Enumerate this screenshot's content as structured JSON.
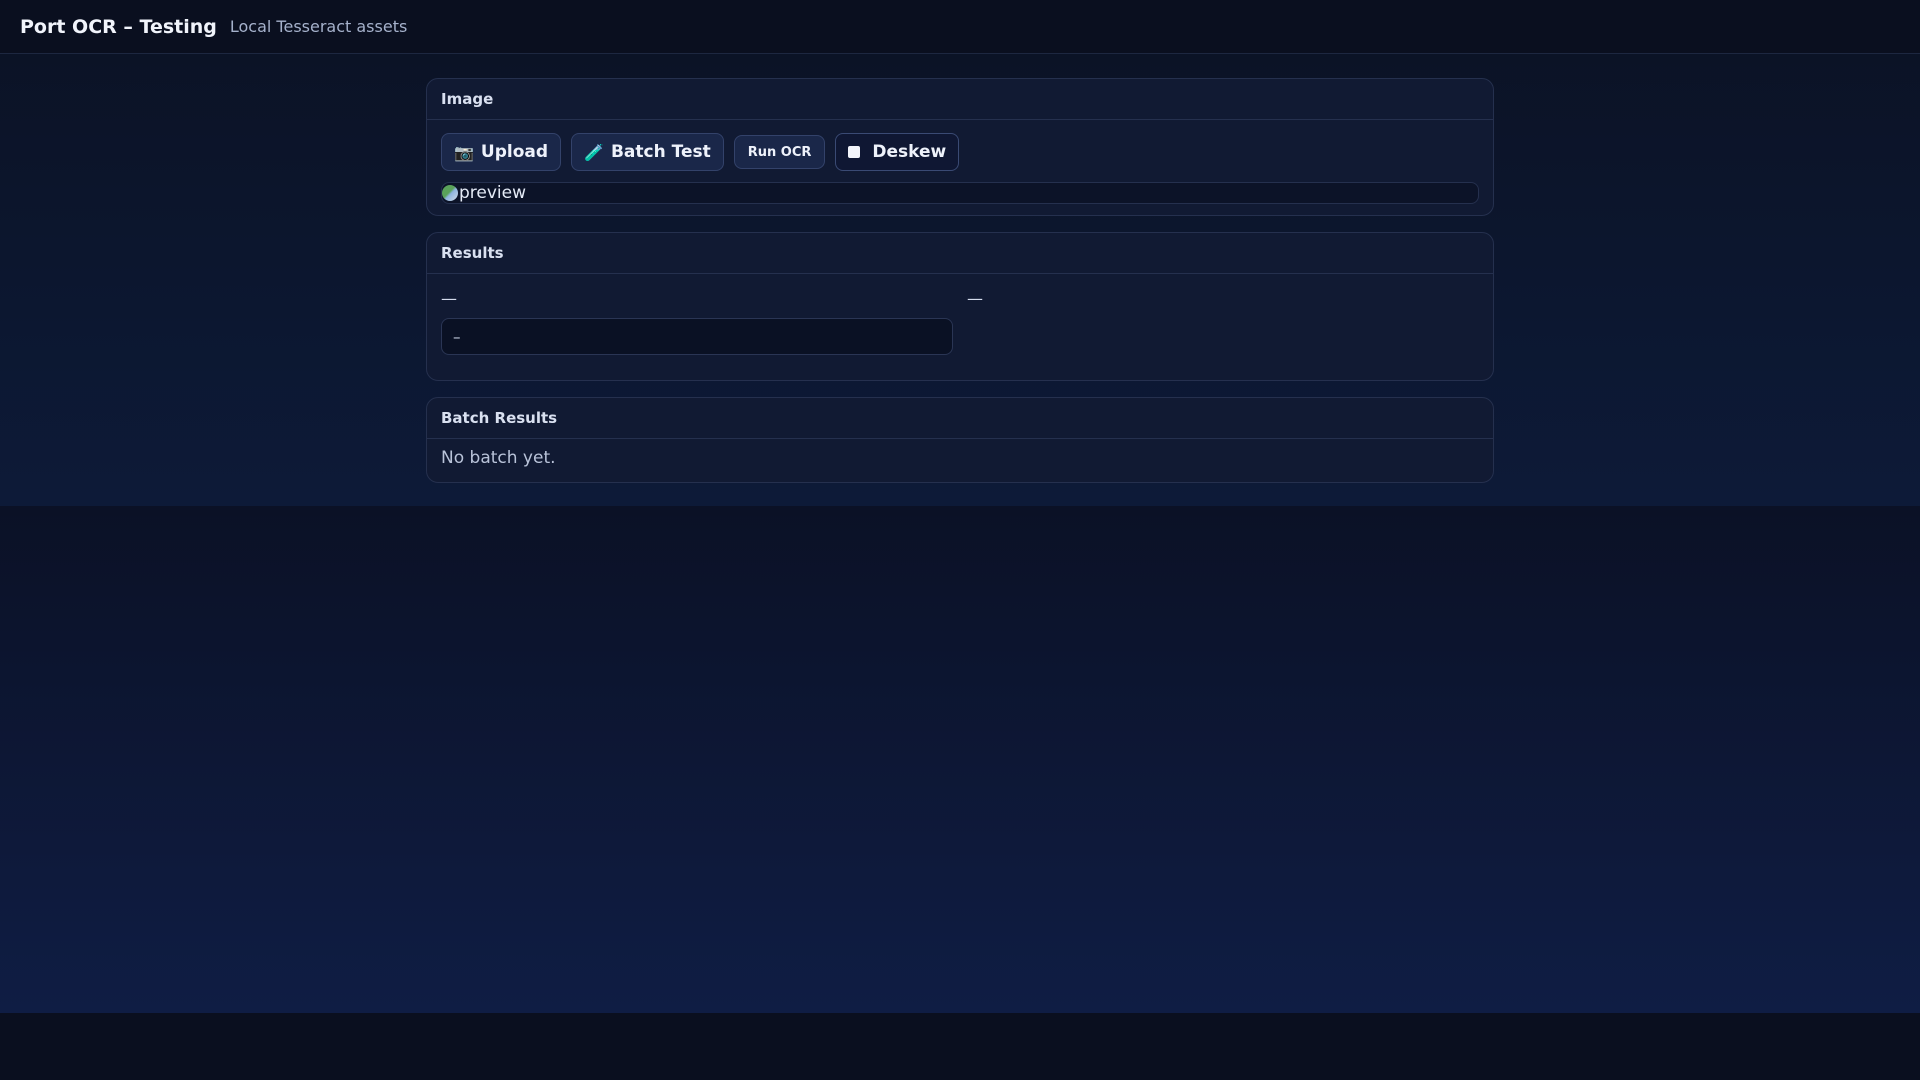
{
  "app": {
    "title": "Port OCR – Testing",
    "subtitle": "Local Tesseract assets"
  },
  "image_panel": {
    "title": "Image",
    "buttons": {
      "upload": {
        "label": "Upload",
        "icon": "camera-icon"
      },
      "batch_test": {
        "label": "Batch Test",
        "icon": "test-tube-icon"
      },
      "run_ocr": {
        "label": "Run OCR"
      },
      "deskew": {
        "label": "Deskew",
        "checked": false
      }
    },
    "preview": {
      "alt": "preview"
    }
  },
  "results_panel": {
    "title": "Results",
    "left_value": "—",
    "right_value": "—",
    "output_text": "–"
  },
  "batch_panel": {
    "title": "Batch Results",
    "empty_message": "No batch yet."
  },
  "colors": {
    "background": "#0a0f1f",
    "card": "#111a33",
    "accent_button": "#1a2749"
  }
}
